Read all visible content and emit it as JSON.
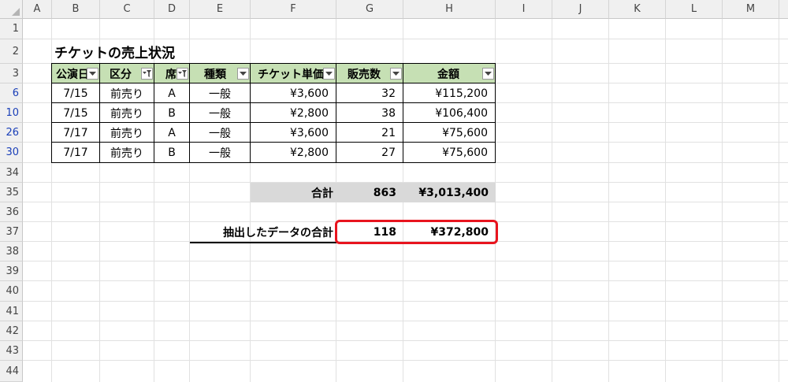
{
  "columns": [
    "A",
    "B",
    "C",
    "D",
    "E",
    "F",
    "G",
    "H",
    "I",
    "J",
    "K",
    "L",
    "M"
  ],
  "rows": [
    "1",
    "2",
    "3",
    "6",
    "10",
    "26",
    "30",
    "34",
    "35",
    "36",
    "37",
    "38",
    "39",
    "40",
    "41",
    "42",
    "43",
    "44"
  ],
  "filtered_rows": [
    "6",
    "10",
    "26",
    "30"
  ],
  "sheet": {
    "title": "チケットの売上状況",
    "headers": [
      "公演日",
      "区分",
      "席",
      "種類",
      "チケット単価",
      "販売数",
      "金額"
    ],
    "data_rows": [
      [
        "7/15",
        "前売り",
        "A",
        "一般",
        "¥3,600",
        "32",
        "¥115,200"
      ],
      [
        "7/15",
        "前売り",
        "B",
        "一般",
        "¥2,800",
        "38",
        "¥106,400"
      ],
      [
        "7/17",
        "前売り",
        "A",
        "一般",
        "¥3,600",
        "21",
        "¥75,600"
      ],
      [
        "7/17",
        "前売り",
        "B",
        "一般",
        "¥2,800",
        "27",
        "¥75,600"
      ]
    ],
    "total": {
      "label": "合計",
      "count": "863",
      "amount": "¥3,013,400"
    },
    "subtotal": {
      "label": "抽出したデータの合計",
      "count": "118",
      "amount": "¥372,800"
    }
  },
  "colors": {
    "header_fill": "#c6e0b4",
    "total_fill": "#d9d9d9",
    "highlight": "#e8141e",
    "filtered_row_number": "#1a3fb8"
  }
}
